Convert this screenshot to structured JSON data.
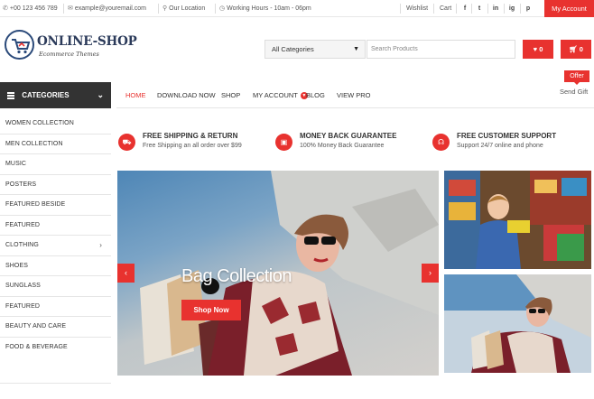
{
  "topbar": {
    "phone": "+00 123 456 789",
    "email": "example@youremail.com",
    "location": "Our Location",
    "hours": "Working Hours - 10am - 06pm",
    "wishlist": "Wishlist",
    "cart": "Cart",
    "social": [
      "f",
      "t",
      "in",
      "ig",
      "p"
    ],
    "my_account": "My Account"
  },
  "logo": {
    "title": "ONLINE-SHOP",
    "subtitle": "Ecommerce Themes"
  },
  "search": {
    "category_selected": "All Categories",
    "placeholder": "Search Products"
  },
  "header_buttons": {
    "wishlist_count": "0",
    "cart_count": "0"
  },
  "categories": {
    "title": "Categories",
    "items": [
      {
        "label": "Women Collection"
      },
      {
        "label": "Men Collection"
      },
      {
        "label": "Music"
      },
      {
        "label": "Posters"
      },
      {
        "label": "Featured Beside"
      },
      {
        "label": "Featured"
      },
      {
        "label": "Clothing"
      },
      {
        "label": "Shoes"
      },
      {
        "label": "Sunglass"
      },
      {
        "label": "Featured"
      },
      {
        "label": "Beauty and Care"
      },
      {
        "label": "Food & Beverage"
      }
    ]
  },
  "nav": {
    "items": [
      "Home",
      "Download Now",
      "Shop",
      "My Account",
      "Blog",
      "View Pro"
    ],
    "offer_badge": "Offer",
    "send_gift": "Send Gift"
  },
  "features": [
    {
      "title": "Free Shipping & Return",
      "subtitle": "Free Shipping an all order over $99"
    },
    {
      "title": "Money Back Guarantee",
      "subtitle": "100% Money Back Guarantee"
    },
    {
      "title": "Free Customer Support",
      "subtitle": "Support 24/7 online and phone"
    }
  ],
  "slider": {
    "title": "Bag Collection",
    "button": "Shop Now",
    "prev": "‹",
    "next": "›"
  },
  "colors": {
    "accent": "#e8322f",
    "dark": "#333333",
    "logo": "#2b3a5a"
  }
}
